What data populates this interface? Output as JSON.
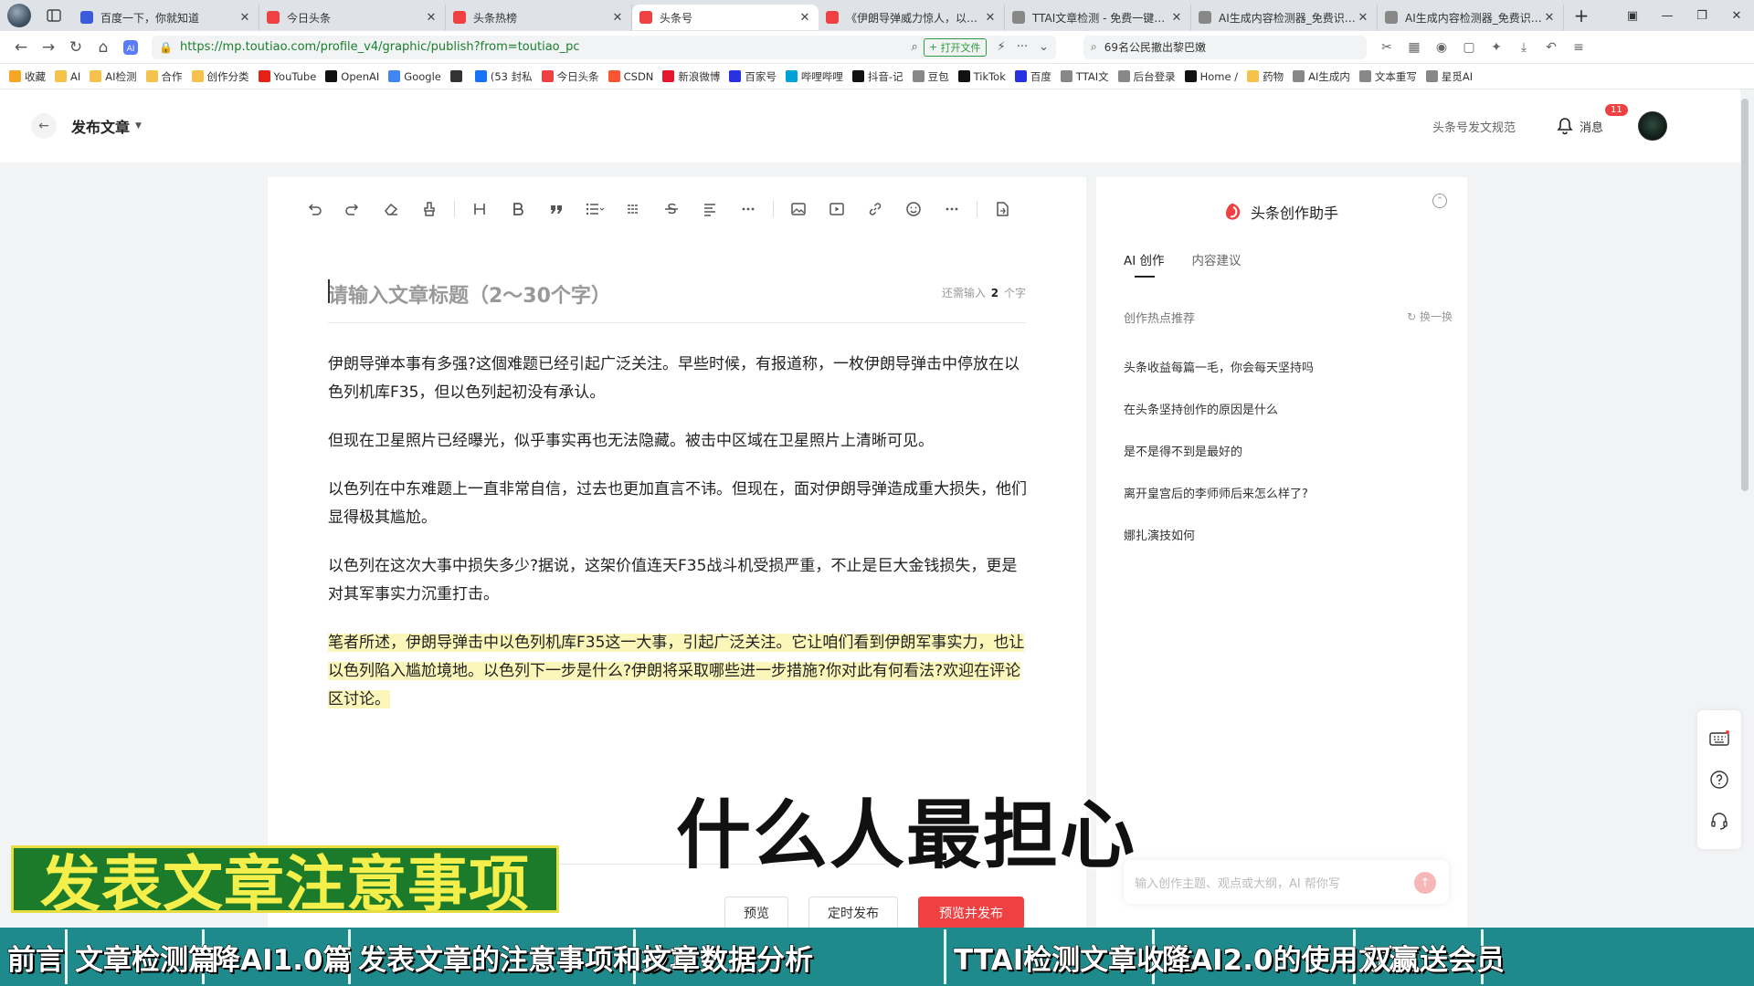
{
  "browser": {
    "tabs": [
      {
        "title": "百度一下，你就知道",
        "color": "#3b5bdb"
      },
      {
        "title": "今日头条",
        "color": "#f04142"
      },
      {
        "title": "头条热榜",
        "color": "#f04142"
      },
      {
        "title": "头条号",
        "color": "#f04142",
        "active": true
      },
      {
        "title": "《伊朗导弹威力惊人，以…",
        "color": "#f04142"
      },
      {
        "title": "TTAI文章检测 - 免费一键…",
        "color": "#888"
      },
      {
        "title": "AI生成内容检测器_免费识…",
        "color": "#888"
      },
      {
        "title": "AI生成内容检测器_免费识…",
        "color": "#888"
      }
    ],
    "url": "https://mp.toutiao.com/profile_v4/graphic/publish?from=toutiao_pc",
    "open_file_label": "打开文件",
    "search_text": "69名公民撤出黎巴嫩",
    "bookmarks": [
      {
        "label": "收藏",
        "icon": "star-icon",
        "color": "#f5a623"
      },
      {
        "label": "AI",
        "icon": "folder-icon",
        "color": "#f5c34b"
      },
      {
        "label": "AI检测",
        "icon": "folder-icon",
        "color": "#f5c34b"
      },
      {
        "label": "合作",
        "icon": "folder-icon",
        "color": "#f5c34b"
      },
      {
        "label": "创作分类",
        "icon": "folder-icon",
        "color": "#f5c34b"
      },
      {
        "label": "YouTube",
        "icon": "youtube-icon",
        "color": "#e62117"
      },
      {
        "label": "OpenAI",
        "icon": "openai-icon",
        "color": "#111"
      },
      {
        "label": "Google",
        "icon": "google-icon",
        "color": "#4285f4"
      },
      {
        "label": "",
        "icon": "link-icon",
        "color": "#333"
      },
      {
        "label": "(53 封私",
        "icon": "zhihu-icon",
        "color": "#1772f6"
      },
      {
        "label": "今日头条",
        "icon": "toutiao-icon",
        "color": "#f04142"
      },
      {
        "label": "CSDN",
        "icon": "csdn-icon",
        "color": "#fc5531"
      },
      {
        "label": "新浪微博",
        "icon": "weibo-icon",
        "color": "#e6162d"
      },
      {
        "label": "百家号",
        "icon": "baijia-icon",
        "color": "#2932e1"
      },
      {
        "label": "哔哩哔哩",
        "icon": "bilibili-icon",
        "color": "#00a1d6"
      },
      {
        "label": "抖音-记",
        "icon": "douyin-icon",
        "color": "#111"
      },
      {
        "label": "豆包",
        "icon": "doubao-icon",
        "color": "#888"
      },
      {
        "label": "TikTok",
        "icon": "tiktok-icon",
        "color": "#111"
      },
      {
        "label": "百度",
        "icon": "baidu-icon",
        "color": "#2932e1"
      },
      {
        "label": "TTAI文",
        "icon": "globe-icon",
        "color": "#888"
      },
      {
        "label": "后台登录",
        "icon": "globe-icon",
        "color": "#888"
      },
      {
        "label": "Home /",
        "icon": "x-icon",
        "color": "#111"
      },
      {
        "label": "药物",
        "icon": "folder-icon",
        "color": "#f5c34b"
      },
      {
        "label": "AI生成内",
        "icon": "globe-icon",
        "color": "#888"
      },
      {
        "label": "文本重写",
        "icon": "globe-icon",
        "color": "#888"
      },
      {
        "label": "星觅AI",
        "icon": "globe-icon",
        "color": "#888"
      }
    ]
  },
  "header": {
    "title": "发布文章",
    "rules_link": "头条号发文规范",
    "messages_label": "消息",
    "messages_badge": "11"
  },
  "editor": {
    "title_placeholder": "请输入文章标题（2～30个字）",
    "title_count_prefix": "还需输入",
    "title_count_num": "2",
    "title_count_suffix": "个字",
    "paragraphs": [
      "伊朗导弹本事有多强?这個难题已经引起广泛关注。早些时候，有报道称，一枚伊朗导弹击中停放在以色列机库F35，但以色列起初没有承认。",
      "但现在卫星照片已经曝光，似乎事实再也无法隐藏。被击中区域在卫星照片上清晰可见。",
      "以色列在中东难题上一直非常自信，过去也更加直言不讳。但现在，面对伊朗导弹造成重大损失，他们显得极其尴尬。",
      "以色列在这次大事中损失多少?据说，这架价值连天F35战斗机受损严重，不止是巨大金钱损失，更是对其军事实力沉重打击。",
      "笔者所述，伊朗导弹击中以色列机库F35这一大事，引起广泛关注。它让咱们看到伊朗军事实力，也让以色列陷入尴尬境地。以色列下一步是什么?伊朗将采取哪些进一步措施?你对此有何看法?欢迎在评论区讨论。"
    ],
    "buttons": {
      "preview": "预览",
      "schedule": "定时发布",
      "publish": "预览并发布"
    }
  },
  "assistant": {
    "title": "头条创作助手",
    "tabs": [
      "AI 创作",
      "内容建议"
    ],
    "hot_heading": "创作热点推荐",
    "refresh_label": "换一换",
    "hot_items": [
      "头条收益每篇一毛，你会每天坚持吗",
      "在头条坚持创作的原因是什么",
      "是不是得不到是最好的",
      "离开皇宫后的李师师后来怎么样了?",
      "娜扎演技如何"
    ],
    "input_placeholder": "输入创作主题、观点或大纲，AI 帮你写"
  },
  "overlay": {
    "subtitle": "什么人最担心",
    "title_banner": "发表文章注意事项",
    "chapters": [
      "前言",
      "文章检测篇",
      "降AI1.0篇",
      "发表文章的注意事项和技巧",
      "文章数据分析",
      "TTAI检测文章收益",
      "降AI2.0的使用方法",
      "双赢送会员"
    ]
  },
  "colors": {
    "brand_red": "#f04142",
    "highlight": "#fbf7ba",
    "chapter_bar": "#1f8a8c",
    "banner_green": "#1c7a2b",
    "banner_text": "#f4ef4a"
  }
}
